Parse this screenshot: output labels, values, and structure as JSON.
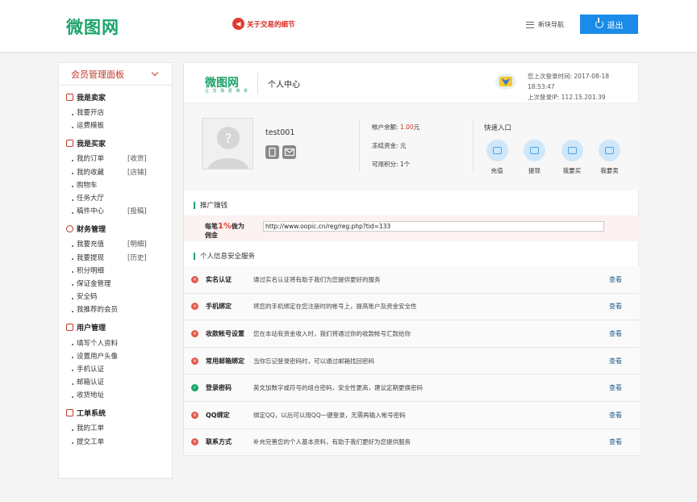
{
  "header": {
    "logo": "微图网",
    "notice": "关于交易的细节",
    "nav_label": "新块导航",
    "logout_label": "退出"
  },
  "sidebar": {
    "title": "会员管理面板",
    "sections": [
      {
        "title": "我是卖家",
        "items": [
          {
            "label": "我要开店",
            "extra": ""
          },
          {
            "label": "运费模板",
            "extra": ""
          }
        ]
      },
      {
        "title": "我是买家",
        "items": [
          {
            "label": "我的订单",
            "extra": "[收货]"
          },
          {
            "label": "我的收藏",
            "extra": "[店铺]"
          },
          {
            "label": "购物车",
            "extra": ""
          },
          {
            "label": "任务大厅",
            "extra": ""
          },
          {
            "label": "稿件中心",
            "extra": "[投稿]"
          }
        ]
      },
      {
        "title": "财务管理",
        "items": [
          {
            "label": "我要充值",
            "extra": "[明细]"
          },
          {
            "label": "我要提现",
            "extra": "[历史]"
          },
          {
            "label": "积分明细",
            "extra": ""
          },
          {
            "label": "保证金管理",
            "extra": ""
          },
          {
            "label": "安全码",
            "extra": ""
          },
          {
            "label": "我推荐的会员",
            "extra": ""
          }
        ]
      },
      {
        "title": "用户管理",
        "items": [
          {
            "label": "填写个人资料",
            "extra": ""
          },
          {
            "label": "设置用户头像",
            "extra": ""
          },
          {
            "label": "手机认证",
            "extra": ""
          },
          {
            "label": "邮箱认证",
            "extra": ""
          },
          {
            "label": "收货地址",
            "extra": ""
          }
        ]
      },
      {
        "title": "工单系统",
        "items": [
          {
            "label": "我的工单",
            "extra": ""
          },
          {
            "label": "提交工单",
            "extra": ""
          }
        ]
      }
    ]
  },
  "main": {
    "logo": "微图网",
    "slogan": "让 交 易 更 简 单",
    "title": "个人中心",
    "last_login_time": "您上次登录时间: 2017-08-18 18:53:47",
    "last_login_ip": "上次登录IP: 112.15.201.39",
    "username": "test001",
    "balance_label": "帐户余额:",
    "balance_value": "1.00",
    "balance_unit": "元",
    "frozen": "冻结资金: 元",
    "points": "可用积分: 1个",
    "quick_title": "快速入口",
    "quick": [
      "充值",
      "提现",
      "我要买",
      "我要卖"
    ],
    "promo_title": "推广赚钱",
    "promo_label_pre": "每笔",
    "promo_pct": "1%",
    "promo_label_post": "做为佣金",
    "promo_url": "http://www.oopic.cn/reg/reg.php?tid=133",
    "security_title": "个人信息安全服务",
    "security": [
      {
        "name": "实名认证",
        "desc": "通过实名认证将有助于我们为您提供更好的服务",
        "ok": false,
        "link": "查看"
      },
      {
        "name": "手机绑定",
        "desc": "将您的手机绑定在您注册时的帐号上，提高账户及资金安全性",
        "ok": false,
        "link": "查看"
      },
      {
        "name": "收款帐号设置",
        "desc": "您在本站有资金收入时，我们将通过你的收款帐号汇款给你",
        "ok": false,
        "link": "查看"
      },
      {
        "name": "常用邮箱绑定",
        "desc": "当你忘记登录密码时，可以通过邮箱找回密码",
        "ok": false,
        "link": "查看"
      },
      {
        "name": "登录密码",
        "desc": "英文加数字或符号的组合密码，安全性更高，建议定期更换密码",
        "ok": true,
        "link": "查看"
      },
      {
        "name": "QQ绑定",
        "desc": "绑定QQ，以后可以用QQ一键登录，无需再输入帐号密码",
        "ok": false,
        "link": "查看"
      },
      {
        "name": "联系方式",
        "desc": "补充完善您的个人基本资料，有助于我们更好为您提供服务",
        "ok": false,
        "link": "查看"
      }
    ]
  },
  "colors": {
    "brand": "#1aa36a",
    "accent": "#1a8be8",
    "alert": "#c0392b"
  }
}
